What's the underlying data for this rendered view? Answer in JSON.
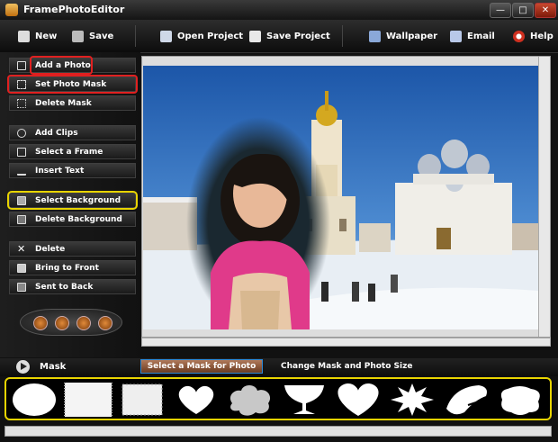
{
  "window": {
    "title": "FramePhotoEditor",
    "minimize": "—",
    "maximize": "□",
    "close": "✕"
  },
  "toolbar": {
    "new": "New",
    "save": "Save",
    "open_project": "Open Project",
    "save_project": "Save Project",
    "wallpaper": "Wallpaper",
    "email": "Email",
    "help": "Help"
  },
  "sidebar": {
    "items": [
      {
        "label": "Add a Photo",
        "icon": "add-photo-icon"
      },
      {
        "label": "Set Photo Mask",
        "icon": "mask-wand-icon"
      },
      {
        "label": "Delete Mask",
        "icon": "delete-mask-icon"
      },
      {
        "label": "Add Clips",
        "icon": "add-clips-icon"
      },
      {
        "label": "Select a Frame",
        "icon": "frame-icon"
      },
      {
        "label": "Insert Text",
        "icon": "text-icon"
      },
      {
        "label": "Select Background",
        "icon": "background-icon"
      },
      {
        "label": "Delete Background",
        "icon": "delete-background-icon"
      },
      {
        "label": "Delete",
        "icon": "delete-icon"
      },
      {
        "label": "Bring to Front",
        "icon": "bring-front-icon"
      },
      {
        "label": "Sent to Back",
        "icon": "send-back-icon"
      }
    ]
  },
  "maskbar": {
    "label": "Mask",
    "tab_select": "Select a Mask for Photo",
    "tab_change": "Change Mask and Photo Size"
  },
  "masks": [
    "oval-mask",
    "torn-paper-mask",
    "rough-square-mask",
    "heart-mask",
    "cloud-mask",
    "goblet-mask",
    "heart-mask-large",
    "starburst-mask",
    "brush-stroke-mask",
    "splat-mask"
  ],
  "colors": {
    "highlight_red": "#e02020",
    "highlight_yellow": "#e8d400",
    "active_tab_border": "#2b88d8"
  }
}
